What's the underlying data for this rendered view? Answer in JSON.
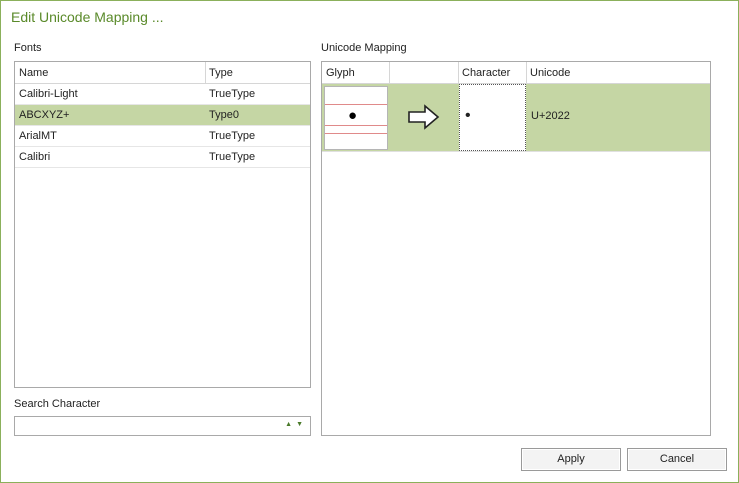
{
  "window": {
    "title": "Edit Unicode Mapping ..."
  },
  "fonts": {
    "label": "Fonts",
    "columns": [
      "Name",
      "Type"
    ],
    "rows": [
      {
        "name": "Calibri-Light",
        "type": "TrueType"
      },
      {
        "name": "ABCXYZ+",
        "type": "Type0"
      },
      {
        "name": "ArialMT",
        "type": "TrueType"
      },
      {
        "name": "Calibri",
        "type": "TrueType"
      }
    ],
    "selected_index": 1
  },
  "search": {
    "label": "Search Character",
    "value": ""
  },
  "mapping": {
    "label": "Unicode Mapping",
    "columns": [
      "Glyph",
      "",
      "Character",
      "Unicode"
    ],
    "rows": [
      {
        "glyph": "●",
        "arrow": "arrow-right-icon",
        "character": "•",
        "unicode": "U+2022"
      }
    ]
  },
  "buttons": {
    "apply": "Apply",
    "cancel": "Cancel"
  },
  "colors": {
    "accent": "#5a8a2a",
    "selection": "#c5d6a4",
    "border": "#8bb05b"
  }
}
